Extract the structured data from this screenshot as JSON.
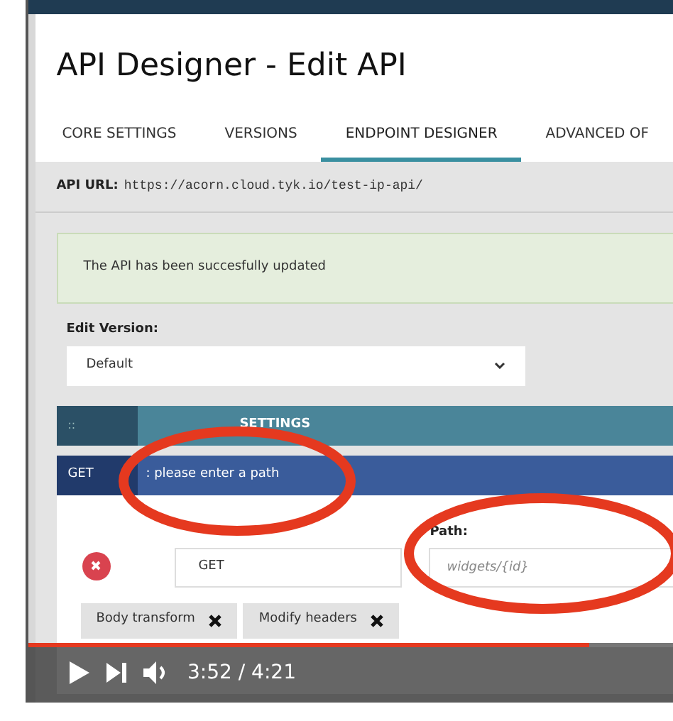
{
  "page": {
    "title": "API Designer - Edit API"
  },
  "tabs": [
    {
      "label": "CORE SETTINGS",
      "selected": false
    },
    {
      "label": "VERSIONS",
      "selected": false
    },
    {
      "label": "ENDPOINT DESIGNER",
      "selected": true
    },
    {
      "label": "ADVANCED OF",
      "selected": false
    }
  ],
  "api_url": {
    "label": "API URL:",
    "value": "https://acorn.cloud.tyk.io/test-ip-api/"
  },
  "alert": {
    "message": "The API has been succesfully updated"
  },
  "edit_version": {
    "label": "Edit Version:",
    "value": "Default"
  },
  "global_settings": {
    "handle": "::",
    "title": "SETTINGS"
  },
  "endpoint": {
    "method": "GET",
    "path_hint": ": please enter a path",
    "method_value": "GET",
    "path_label": "Path:",
    "path_placeholder": "widgets/{id}",
    "plugins": [
      {
        "label": "Body transform"
      },
      {
        "label": "Modify headers"
      }
    ]
  },
  "player": {
    "progress": {
      "level": 0.87
    },
    "time": "3:52 / 4:21"
  }
}
